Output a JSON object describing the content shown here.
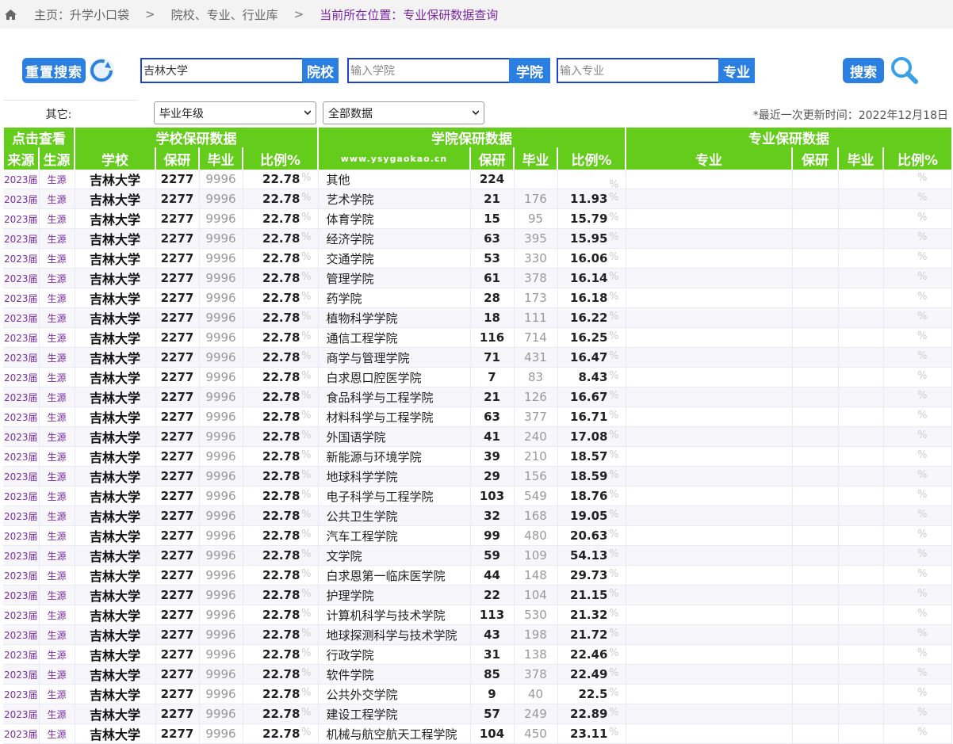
{
  "breadcrumb": {
    "home_label": "主页：升学小口袋",
    "sep": ">",
    "section": "院校、专业、行业库",
    "current": "当前所在位置：专业保研数据查询"
  },
  "search": {
    "reset_label": "重置搜索",
    "school_value": "吉林大学",
    "school_btn": "院校",
    "college_placeholder": "输入学院",
    "college_btn": "学院",
    "major_placeholder": "输入专业",
    "major_btn": "专业",
    "search_label": "搜索"
  },
  "filters": {
    "other_label": "其它:",
    "year_select": "毕业年级",
    "data_select": "全部数据",
    "update_text": "*最近一次更新时间：2022年12月18日"
  },
  "table": {
    "group_headers": [
      "点击查看",
      "学校保研数据",
      "学院保研数据",
      "专业保研数据"
    ],
    "columns": [
      "来源",
      "生源",
      "学校",
      "保研",
      "毕业",
      "比例%",
      "www.ysygaokao.cn",
      "保研",
      "毕业",
      "比例%",
      "专业",
      "保研",
      "毕业",
      "比例%"
    ],
    "pct_sign": "%",
    "school_row": {
      "src": "2023届",
      "stu": "生源",
      "school": "吉林大学",
      "baoyan": "2277",
      "biye": "9996",
      "ratio": "22.78"
    },
    "rows": [
      {
        "college": "其他",
        "baoyan": "224",
        "biye": "",
        "ratio": ""
      },
      {
        "college": "艺术学院",
        "baoyan": "21",
        "biye": "176",
        "ratio": "11.93"
      },
      {
        "college": "体育学院",
        "baoyan": "15",
        "biye": "95",
        "ratio": "15.79"
      },
      {
        "college": "经济学院",
        "baoyan": "63",
        "biye": "395",
        "ratio": "15.95"
      },
      {
        "college": "交通学院",
        "baoyan": "53",
        "biye": "330",
        "ratio": "16.06"
      },
      {
        "college": "管理学院",
        "baoyan": "61",
        "biye": "378",
        "ratio": "16.14"
      },
      {
        "college": "药学院",
        "baoyan": "28",
        "biye": "173",
        "ratio": "16.18"
      },
      {
        "college": "植物科学学院",
        "baoyan": "18",
        "biye": "111",
        "ratio": "16.22"
      },
      {
        "college": "通信工程学院",
        "baoyan": "116",
        "biye": "714",
        "ratio": "16.25"
      },
      {
        "college": "商学与管理学院",
        "baoyan": "71",
        "biye": "431",
        "ratio": "16.47"
      },
      {
        "college": "白求恩口腔医学院",
        "baoyan": "7",
        "biye": "83",
        "ratio": "8.43"
      },
      {
        "college": "食品科学与工程学院",
        "baoyan": "21",
        "biye": "126",
        "ratio": "16.67"
      },
      {
        "college": "材料科学与工程学院",
        "baoyan": "63",
        "biye": "377",
        "ratio": "16.71"
      },
      {
        "college": "外国语学院",
        "baoyan": "41",
        "biye": "240",
        "ratio": "17.08"
      },
      {
        "college": "新能源与环境学院",
        "baoyan": "39",
        "biye": "210",
        "ratio": "18.57"
      },
      {
        "college": "地球科学学院",
        "baoyan": "29",
        "biye": "156",
        "ratio": "18.59"
      },
      {
        "college": "电子科学与工程学院",
        "baoyan": "103",
        "biye": "549",
        "ratio": "18.76"
      },
      {
        "college": "公共卫生学院",
        "baoyan": "32",
        "biye": "168",
        "ratio": "19.05"
      },
      {
        "college": "汽车工程学院",
        "baoyan": "99",
        "biye": "480",
        "ratio": "20.63"
      },
      {
        "college": "文学院",
        "baoyan": "59",
        "biye": "109",
        "ratio": "54.13"
      },
      {
        "college": "白求恩第一临床医学院",
        "baoyan": "44",
        "biye": "148",
        "ratio": "29.73"
      },
      {
        "college": "护理学院",
        "baoyan": "22",
        "biye": "104",
        "ratio": "21.15"
      },
      {
        "college": "计算机科学与技术学院",
        "baoyan": "113",
        "biye": "530",
        "ratio": "21.32"
      },
      {
        "college": "地球探测科学与技术学院",
        "baoyan": "43",
        "biye": "198",
        "ratio": "21.72"
      },
      {
        "college": "行政学院",
        "baoyan": "31",
        "biye": "138",
        "ratio": "22.46"
      },
      {
        "college": "软件学院",
        "baoyan": "85",
        "biye": "378",
        "ratio": "22.49"
      },
      {
        "college": "公共外交学院",
        "baoyan": "9",
        "biye": "40",
        "ratio": "22.5"
      },
      {
        "college": "建设工程学院",
        "baoyan": "57",
        "biye": "249",
        "ratio": "22.89"
      },
      {
        "college": "机械与航空航天工程学院",
        "baoyan": "104",
        "biye": "450",
        "ratio": "23.11"
      }
    ]
  }
}
